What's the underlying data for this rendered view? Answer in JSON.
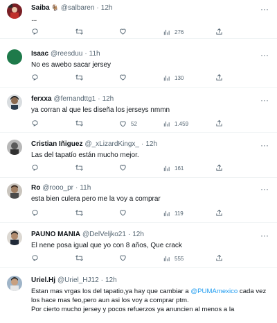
{
  "tweets": [
    {
      "name": "Saiba",
      "name_emoji": "🐐",
      "handle": "@salbaren",
      "time": "12h",
      "text": "...",
      "replies": "",
      "retweets": "",
      "likes": "",
      "views": "276"
    },
    {
      "name": "Isaac",
      "handle": "@reesduu",
      "time": "11h",
      "text": "No es awebo sacar jersey",
      "replies": "",
      "retweets": "",
      "likes": "",
      "views": "130"
    },
    {
      "name": "ferxxa",
      "handle": "@fernandttg1",
      "time": "12h",
      "text": "ya corran al que les diseña los jerseys nmmn",
      "replies": "",
      "retweets": "",
      "likes": "52",
      "views": "1.459"
    },
    {
      "name": "Cristian Iñiguez",
      "handle": "@_xLizardKingx_",
      "time": "12h",
      "text": "Las del tapatío están mucho mejor.",
      "replies": "",
      "retweets": "",
      "likes": "",
      "views": "161"
    },
    {
      "name": "Ro",
      "handle": "@rooo_pr",
      "time": "11h",
      "text": "esta bien culera pero me la voy a comprar",
      "replies": "",
      "retweets": "",
      "likes": "",
      "views": "119"
    },
    {
      "name": "PAUNO MANIA",
      "handle": "@DelVeljko21",
      "time": "12h",
      "text": "El nene posa igual que yo con 8 años, Que crack",
      "replies": "",
      "retweets": "",
      "likes": "",
      "views": "555"
    },
    {
      "name": "Uriel.Hj",
      "handle": "@Uriel_HJ12",
      "time": "12h",
      "text_before": "Estan mas vrgas los del tapatio,ya hay que cambiar a ",
      "mention": "@PUMAmexico",
      "text_after": " cada vez los hace mas feo,pero aun asi los voy a comprar ptm.",
      "text_line3": "Por cierto mucho jersey y pocos refuerzos ya anuncien al menos a la"
    }
  ],
  "colors": {
    "text": "#0f1419",
    "muted": "#536471",
    "link": "#1d9bf0",
    "border": "#eff3f4"
  },
  "icons": [
    "reply-icon",
    "retweet-icon",
    "like-icon",
    "views-icon",
    "share-icon",
    "more-icon"
  ]
}
